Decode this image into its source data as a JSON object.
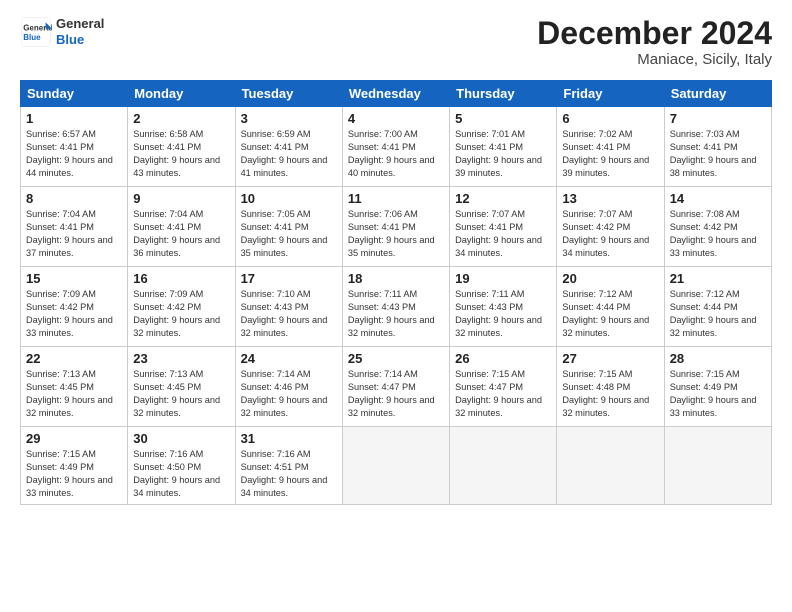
{
  "header": {
    "logo_line1": "General",
    "logo_line2": "Blue",
    "month": "December 2024",
    "location": "Maniace, Sicily, Italy"
  },
  "weekdays": [
    "Sunday",
    "Monday",
    "Tuesday",
    "Wednesday",
    "Thursday",
    "Friday",
    "Saturday"
  ],
  "weeks": [
    [
      {
        "day": "1",
        "sunrise": "Sunrise: 6:57 AM",
        "sunset": "Sunset: 4:41 PM",
        "daylight": "Daylight: 9 hours and 44 minutes."
      },
      {
        "day": "2",
        "sunrise": "Sunrise: 6:58 AM",
        "sunset": "Sunset: 4:41 PM",
        "daylight": "Daylight: 9 hours and 43 minutes."
      },
      {
        "day": "3",
        "sunrise": "Sunrise: 6:59 AM",
        "sunset": "Sunset: 4:41 PM",
        "daylight": "Daylight: 9 hours and 41 minutes."
      },
      {
        "day": "4",
        "sunrise": "Sunrise: 7:00 AM",
        "sunset": "Sunset: 4:41 PM",
        "daylight": "Daylight: 9 hours and 40 minutes."
      },
      {
        "day": "5",
        "sunrise": "Sunrise: 7:01 AM",
        "sunset": "Sunset: 4:41 PM",
        "daylight": "Daylight: 9 hours and 39 minutes."
      },
      {
        "day": "6",
        "sunrise": "Sunrise: 7:02 AM",
        "sunset": "Sunset: 4:41 PM",
        "daylight": "Daylight: 9 hours and 39 minutes."
      },
      {
        "day": "7",
        "sunrise": "Sunrise: 7:03 AM",
        "sunset": "Sunset: 4:41 PM",
        "daylight": "Daylight: 9 hours and 38 minutes."
      }
    ],
    [
      {
        "day": "8",
        "sunrise": "Sunrise: 7:04 AM",
        "sunset": "Sunset: 4:41 PM",
        "daylight": "Daylight: 9 hours and 37 minutes."
      },
      {
        "day": "9",
        "sunrise": "Sunrise: 7:04 AM",
        "sunset": "Sunset: 4:41 PM",
        "daylight": "Daylight: 9 hours and 36 minutes."
      },
      {
        "day": "10",
        "sunrise": "Sunrise: 7:05 AM",
        "sunset": "Sunset: 4:41 PM",
        "daylight": "Daylight: 9 hours and 35 minutes."
      },
      {
        "day": "11",
        "sunrise": "Sunrise: 7:06 AM",
        "sunset": "Sunset: 4:41 PM",
        "daylight": "Daylight: 9 hours and 35 minutes."
      },
      {
        "day": "12",
        "sunrise": "Sunrise: 7:07 AM",
        "sunset": "Sunset: 4:41 PM",
        "daylight": "Daylight: 9 hours and 34 minutes."
      },
      {
        "day": "13",
        "sunrise": "Sunrise: 7:07 AM",
        "sunset": "Sunset: 4:42 PM",
        "daylight": "Daylight: 9 hours and 34 minutes."
      },
      {
        "day": "14",
        "sunrise": "Sunrise: 7:08 AM",
        "sunset": "Sunset: 4:42 PM",
        "daylight": "Daylight: 9 hours and 33 minutes."
      }
    ],
    [
      {
        "day": "15",
        "sunrise": "Sunrise: 7:09 AM",
        "sunset": "Sunset: 4:42 PM",
        "daylight": "Daylight: 9 hours and 33 minutes."
      },
      {
        "day": "16",
        "sunrise": "Sunrise: 7:09 AM",
        "sunset": "Sunset: 4:42 PM",
        "daylight": "Daylight: 9 hours and 32 minutes."
      },
      {
        "day": "17",
        "sunrise": "Sunrise: 7:10 AM",
        "sunset": "Sunset: 4:43 PM",
        "daylight": "Daylight: 9 hours and 32 minutes."
      },
      {
        "day": "18",
        "sunrise": "Sunrise: 7:11 AM",
        "sunset": "Sunset: 4:43 PM",
        "daylight": "Daylight: 9 hours and 32 minutes."
      },
      {
        "day": "19",
        "sunrise": "Sunrise: 7:11 AM",
        "sunset": "Sunset: 4:43 PM",
        "daylight": "Daylight: 9 hours and 32 minutes."
      },
      {
        "day": "20",
        "sunrise": "Sunrise: 7:12 AM",
        "sunset": "Sunset: 4:44 PM",
        "daylight": "Daylight: 9 hours and 32 minutes."
      },
      {
        "day": "21",
        "sunrise": "Sunrise: 7:12 AM",
        "sunset": "Sunset: 4:44 PM",
        "daylight": "Daylight: 9 hours and 32 minutes."
      }
    ],
    [
      {
        "day": "22",
        "sunrise": "Sunrise: 7:13 AM",
        "sunset": "Sunset: 4:45 PM",
        "daylight": "Daylight: 9 hours and 32 minutes."
      },
      {
        "day": "23",
        "sunrise": "Sunrise: 7:13 AM",
        "sunset": "Sunset: 4:45 PM",
        "daylight": "Daylight: 9 hours and 32 minutes."
      },
      {
        "day": "24",
        "sunrise": "Sunrise: 7:14 AM",
        "sunset": "Sunset: 4:46 PM",
        "daylight": "Daylight: 9 hours and 32 minutes."
      },
      {
        "day": "25",
        "sunrise": "Sunrise: 7:14 AM",
        "sunset": "Sunset: 4:47 PM",
        "daylight": "Daylight: 9 hours and 32 minutes."
      },
      {
        "day": "26",
        "sunrise": "Sunrise: 7:15 AM",
        "sunset": "Sunset: 4:47 PM",
        "daylight": "Daylight: 9 hours and 32 minutes."
      },
      {
        "day": "27",
        "sunrise": "Sunrise: 7:15 AM",
        "sunset": "Sunset: 4:48 PM",
        "daylight": "Daylight: 9 hours and 32 minutes."
      },
      {
        "day": "28",
        "sunrise": "Sunrise: 7:15 AM",
        "sunset": "Sunset: 4:49 PM",
        "daylight": "Daylight: 9 hours and 33 minutes."
      }
    ],
    [
      {
        "day": "29",
        "sunrise": "Sunrise: 7:15 AM",
        "sunset": "Sunset: 4:49 PM",
        "daylight": "Daylight: 9 hours and 33 minutes."
      },
      {
        "day": "30",
        "sunrise": "Sunrise: 7:16 AM",
        "sunset": "Sunset: 4:50 PM",
        "daylight": "Daylight: 9 hours and 34 minutes."
      },
      {
        "day": "31",
        "sunrise": "Sunrise: 7:16 AM",
        "sunset": "Sunset: 4:51 PM",
        "daylight": "Daylight: 9 hours and 34 minutes."
      },
      null,
      null,
      null,
      null
    ]
  ]
}
